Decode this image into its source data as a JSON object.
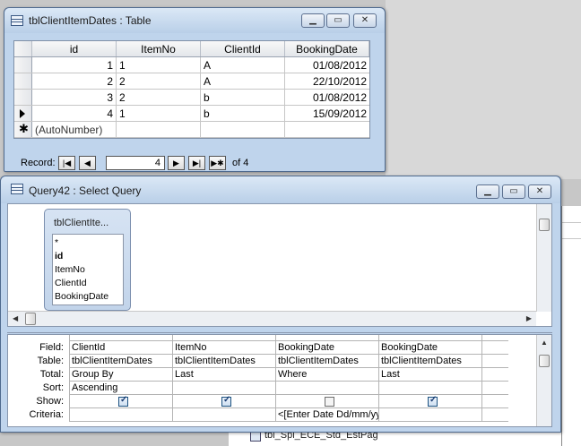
{
  "table_window": {
    "title": "tblClientItemDates : Table",
    "columns": [
      "id",
      "ItemNo",
      "ClientId",
      "BookingDate"
    ],
    "rows": [
      {
        "id": "1",
        "ItemNo": "1",
        "ClientId": "A",
        "BookingDate": "01/08/2012"
      },
      {
        "id": "2",
        "ItemNo": "2",
        "ClientId": "A",
        "BookingDate": "22/10/2012"
      },
      {
        "id": "3",
        "ItemNo": "2",
        "ClientId": "b",
        "BookingDate": "01/08/2012"
      },
      {
        "id": "4",
        "ItemNo": "1",
        "ClientId": "b",
        "BookingDate": "15/09/2012"
      }
    ],
    "new_row_placeholder": "(AutoNumber)",
    "nav": {
      "label": "Record:",
      "current": "4",
      "of_text": "of 4"
    }
  },
  "query_window": {
    "title": "Query42 : Select Query",
    "field_list": {
      "title": "tblClientIte...",
      "fields": [
        "*",
        "id",
        "ItemNo",
        "ClientId",
        "BookingDate"
      ]
    },
    "grid": {
      "row_labels": [
        "Field:",
        "Table:",
        "Total:",
        "Sort:",
        "Show:",
        "Criteria:"
      ],
      "columns": [
        {
          "field": "ClientId",
          "table": "tblClientItemDates",
          "total": "Group By",
          "sort": "Ascending",
          "show": true,
          "criteria": ""
        },
        {
          "field": "ItemNo",
          "table": "tblClientItemDates",
          "total": "Last",
          "sort": "",
          "show": true,
          "criteria": ""
        },
        {
          "field": "BookingDate",
          "table": "tblClientItemDates",
          "total": "Where",
          "sort": "",
          "show": false,
          "criteria": "<[Enter Date Dd/mm/yyyy]"
        },
        {
          "field": "BookingDate",
          "table": "tblClientItemDates",
          "total": "Last",
          "sort": "",
          "show": true,
          "criteria": ""
        }
      ]
    }
  },
  "background": {
    "list_item": "tbl_Spl_ECE_Std_EstPag"
  }
}
